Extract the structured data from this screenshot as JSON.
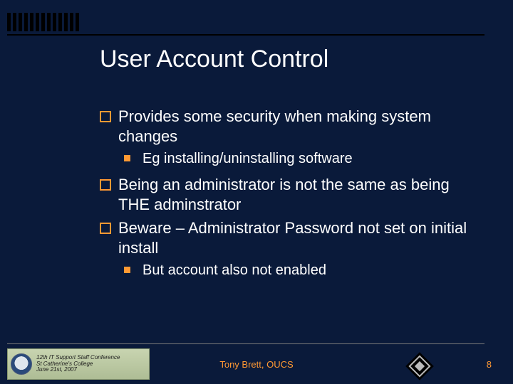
{
  "title": "User Account Control",
  "bullets": {
    "b1": "Provides some security when making system changes",
    "b1_sub": "Eg installing/uninstalling software",
    "b2": "Being an administrator is not the same as being THE adminstrator",
    "b3": "Beware – Administrator Password not set on initial install",
    "b3_sub": "But account also not enabled"
  },
  "footer": {
    "badge_line1": "12th IT Support Staff Conference",
    "badge_line2": "St Catherine's College",
    "badge_line3": "June 21st, 2007",
    "center": "Tony Brett, OUCS",
    "page": "8"
  },
  "colors": {
    "background": "#0a1a3a",
    "accent": "#ff9933"
  }
}
